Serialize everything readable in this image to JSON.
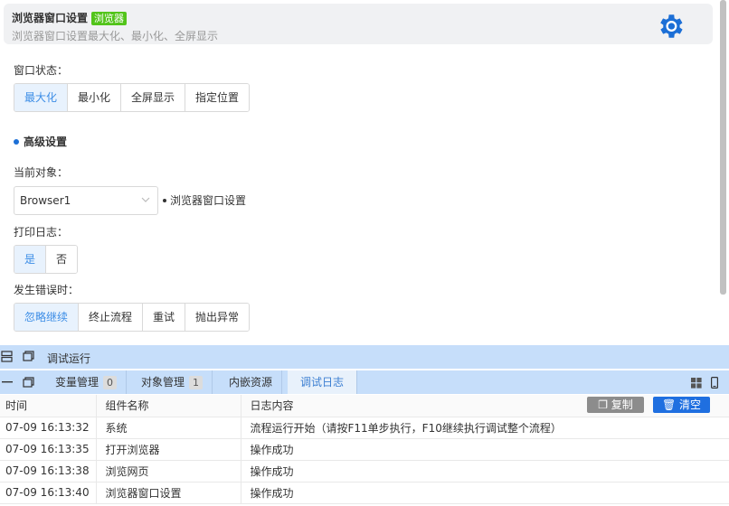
{
  "header": {
    "title": "浏览器窗口设置",
    "tag": "浏览器",
    "subtitle": "浏览器窗口设置最大化、最小化、全屏显示"
  },
  "window_state": {
    "label": "窗口状态：",
    "options": [
      "最大化",
      "最小化",
      "全屏显示",
      "指定位置"
    ],
    "selected": "最大化"
  },
  "advanced": {
    "title": "高级设置"
  },
  "current_object": {
    "label": "当前对象：",
    "value": "Browser1",
    "object_name": "浏览器窗口设置"
  },
  "print_log": {
    "label": "打印日志：",
    "options": [
      "是",
      "否"
    ],
    "selected": "是"
  },
  "on_error": {
    "label": "发生错误时：",
    "options": [
      "忽略继续",
      "终止流程",
      "重试",
      "抛出异常"
    ],
    "selected": "忽略继续"
  },
  "debug_bar": {
    "title": "调试运行"
  },
  "tabs": [
    {
      "label": "变量管理",
      "count": "0"
    },
    {
      "label": "对象管理",
      "count": "1"
    },
    {
      "label": "内嵌资源"
    },
    {
      "label": "调试日志"
    }
  ],
  "active_tab": "调试日志",
  "log": {
    "headers": [
      "时间",
      "组件名称",
      "日志内容"
    ],
    "copy_label": "复制",
    "clear_label": "清空",
    "rows": [
      [
        "07-09 16:13:32",
        "系统",
        "流程运行开始（请按F11单步执行，F10继续执行调试整个流程）"
      ],
      [
        "07-09 16:13:35",
        "打开浏览器",
        "操作成功"
      ],
      [
        "07-09 16:13:38",
        "浏览网页",
        "操作成功"
      ],
      [
        "07-09 16:13:40",
        "浏览器窗口设置",
        "操作成功"
      ]
    ]
  },
  "colors": {
    "accent": "#3c8de6",
    "tag_green": "#52c41a",
    "panel_blue": "#c6defa",
    "clear_button": "#1f6fe0",
    "gear": "#1c6fd6"
  }
}
